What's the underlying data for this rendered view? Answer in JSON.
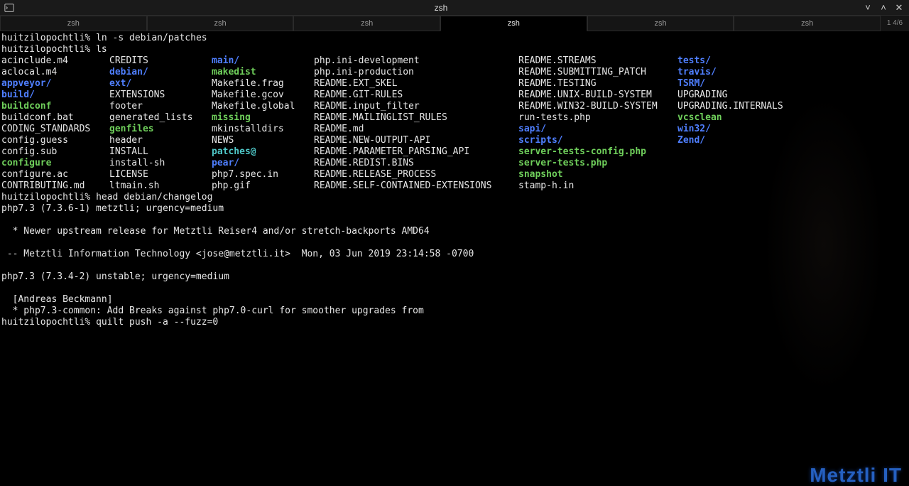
{
  "window": {
    "title": "zsh",
    "tab_count": "1  4/6"
  },
  "tabs": [
    "zsh",
    "zsh",
    "zsh",
    "zsh",
    "zsh",
    "zsh"
  ],
  "active_tab": 3,
  "prompts": {
    "p1_host": "huitzilopochtli% ",
    "p1_cmd": "ln -s debian/patches",
    "p2_host": "huitzilopochtli% ",
    "p2_cmd": "ls",
    "p3_host": "huitzilopochtli% ",
    "p3_cmd": "head debian/changelog",
    "p4_host": "huitzilopochtli% ",
    "p4_cmd": "quilt push -a --fuzz=0"
  },
  "ls": [
    [
      {
        "t": "acinclude.m4"
      },
      {
        "t": "CREDITS"
      },
      {
        "t": "main/",
        "c": "blue"
      },
      {
        "t": "php.ini-development"
      },
      {
        "t": "README.STREAMS"
      },
      {
        "t": "tests/",
        "c": "blue"
      }
    ],
    [
      {
        "t": "aclocal.m4"
      },
      {
        "t": "debian/",
        "c": "blue"
      },
      {
        "t": "makedist",
        "c": "green"
      },
      {
        "t": "php.ini-production"
      },
      {
        "t": "README.SUBMITTING_PATCH"
      },
      {
        "t": "travis/",
        "c": "blue"
      }
    ],
    [
      {
        "t": "appveyor/",
        "c": "blue"
      },
      {
        "t": "ext/",
        "c": "blue"
      },
      {
        "t": "Makefile.frag"
      },
      {
        "t": "README.EXT_SKEL"
      },
      {
        "t": "README.TESTING"
      },
      {
        "t": "TSRM/",
        "c": "blue"
      }
    ],
    [
      {
        "t": "build/",
        "c": "blue"
      },
      {
        "t": "EXTENSIONS"
      },
      {
        "t": "Makefile.gcov"
      },
      {
        "t": "README.GIT-RULES"
      },
      {
        "t": "README.UNIX-BUILD-SYSTEM"
      },
      {
        "t": "UPGRADING"
      }
    ],
    [
      {
        "t": "buildconf",
        "c": "green"
      },
      {
        "t": "footer"
      },
      {
        "t": "Makefile.global"
      },
      {
        "t": "README.input_filter"
      },
      {
        "t": "README.WIN32-BUILD-SYSTEM"
      },
      {
        "t": "UPGRADING.INTERNALS"
      }
    ],
    [
      {
        "t": "buildconf.bat"
      },
      {
        "t": "generated_lists"
      },
      {
        "t": "missing",
        "c": "green"
      },
      {
        "t": "README.MAILINGLIST_RULES"
      },
      {
        "t": "run-tests.php"
      },
      {
        "t": "vcsclean",
        "c": "green"
      }
    ],
    [
      {
        "t": "CODING_STANDARDS"
      },
      {
        "t": "genfiles",
        "c": "green"
      },
      {
        "t": "mkinstalldirs"
      },
      {
        "t": "README.md"
      },
      {
        "t": "sapi/",
        "c": "blue"
      },
      {
        "t": "win32/",
        "c": "blue"
      }
    ],
    [
      {
        "t": "config.guess"
      },
      {
        "t": "header"
      },
      {
        "t": "NEWS"
      },
      {
        "t": "README.NEW-OUTPUT-API"
      },
      {
        "t": "scripts/",
        "c": "blue"
      },
      {
        "t": "Zend/",
        "c": "blue"
      }
    ],
    [
      {
        "t": "config.sub"
      },
      {
        "t": "INSTALL"
      },
      {
        "t": "patches@",
        "c": "cyan"
      },
      {
        "t": "README.PARAMETER_PARSING_API"
      },
      {
        "t": "server-tests-config.php",
        "c": "green"
      },
      {
        "t": ""
      }
    ],
    [
      {
        "t": "configure",
        "c": "green"
      },
      {
        "t": "install-sh"
      },
      {
        "t": "pear/",
        "c": "blue"
      },
      {
        "t": "README.REDIST.BINS"
      },
      {
        "t": "server-tests.php",
        "c": "green"
      },
      {
        "t": ""
      }
    ],
    [
      {
        "t": "configure.ac"
      },
      {
        "t": "LICENSE"
      },
      {
        "t": "php7.spec.in"
      },
      {
        "t": "README.RELEASE_PROCESS"
      },
      {
        "t": "snapshot",
        "c": "green"
      },
      {
        "t": ""
      }
    ],
    [
      {
        "t": "CONTRIBUTING.md"
      },
      {
        "t": "ltmain.sh"
      },
      {
        "t": "php.gif"
      },
      {
        "t": "README.SELF-CONTAINED-EXTENSIONS"
      },
      {
        "t": "stamp-h.in"
      },
      {
        "t": ""
      }
    ]
  ],
  "changelog": [
    "php7.3 (7.3.6-1) metztli; urgency=medium",
    "",
    "  * Newer upstream release for Metztli Reiser4 and/or stretch-backports AMD64",
    "",
    " -- Metztli Information Technology <jose@metztli.it>  Mon, 03 Jun 2019 23:14:58 -0700",
    "",
    "php7.3 (7.3.4-2) unstable; urgency=medium",
    "",
    "  [Andreas Beckmann]",
    "  * php7.3-common: Add Breaks against php7.0-curl for smoother upgrades from"
  ],
  "watermark": "Metztli IT"
}
